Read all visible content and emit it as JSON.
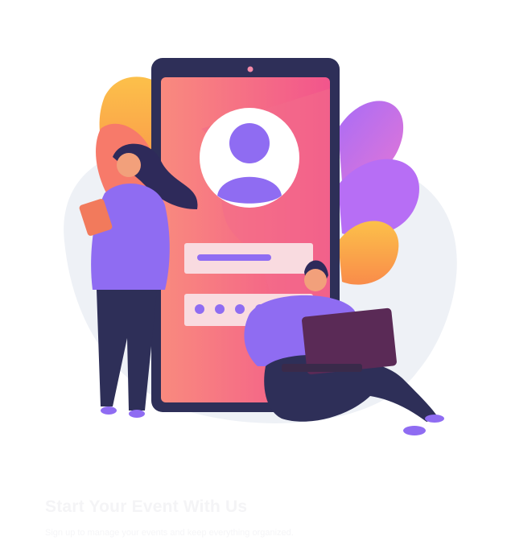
{
  "illustration": {
    "icon": "user-login-illustration",
    "password_dots": 4,
    "colors": {
      "phone_gradient_start": "#f87a83",
      "phone_gradient_end": "#f2558c",
      "phone_frame": "#2e2f58",
      "accent_purple": "#8f6cf2",
      "leaf_orange": "#fbb23c",
      "leaf_violet": "#b76ef5",
      "backdrop": "#eef1f6"
    }
  },
  "caption": {
    "title": "Start Your Event With Us",
    "subtitle": "Sign up to manage your events and keep everything organized."
  }
}
